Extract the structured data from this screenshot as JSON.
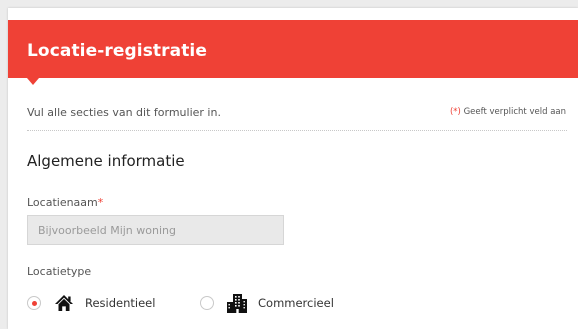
{
  "form": {
    "title": "Locatie-registratie",
    "instructions": "Vul alle secties van dit formulier in.",
    "required_note": {
      "marker": "(*)",
      "text": "Geeft verplicht veld aan"
    },
    "accent_color": "#ef4136"
  },
  "section": {
    "title": "Algemene informatie"
  },
  "fields": {
    "location_name": {
      "label": "Locatienaam",
      "required_marker": "*",
      "value": "",
      "placeholder": "Bijvoorbeeld Mijn woning"
    },
    "location_type": {
      "label": "Locatietype",
      "selected": "Residentieel",
      "options": [
        {
          "label": "Residentieel",
          "icon": "house-icon",
          "checked": true
        },
        {
          "label": "Commercieel",
          "icon": "office-building-icon",
          "checked": false
        }
      ]
    }
  }
}
